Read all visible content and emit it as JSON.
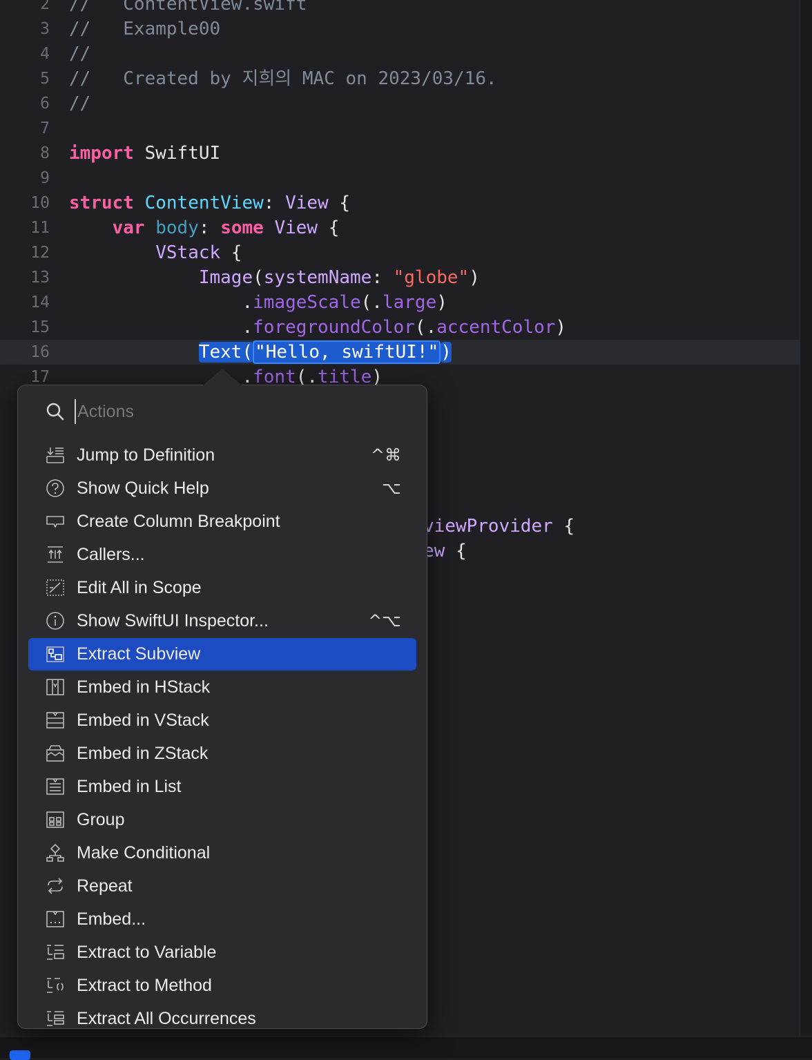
{
  "code_lines": [
    {
      "num": "2",
      "tokens": [
        {
          "t": "//   ContentView.swift",
          "c": "cm"
        }
      ]
    },
    {
      "num": "3",
      "tokens": [
        {
          "t": "//   Example00",
          "c": "cm"
        }
      ]
    },
    {
      "num": "4",
      "tokens": [
        {
          "t": "//",
          "c": "cm"
        }
      ]
    },
    {
      "num": "5",
      "tokens": [
        {
          "t": "//   Created by 지희의 MAC on 2023/03/16.",
          "c": "cm"
        }
      ]
    },
    {
      "num": "6",
      "tokens": [
        {
          "t": "//",
          "c": "cm"
        }
      ]
    },
    {
      "num": "7",
      "tokens": []
    },
    {
      "num": "8",
      "tokens": [
        {
          "t": "import",
          "c": "kw"
        },
        {
          "t": " SwiftUI",
          "c": ""
        }
      ]
    },
    {
      "num": "9",
      "tokens": []
    },
    {
      "num": "10",
      "tokens": [
        {
          "t": "struct",
          "c": "kw"
        },
        {
          "t": " ",
          "c": ""
        },
        {
          "t": "ContentView",
          "c": "td"
        },
        {
          "t": ": ",
          "c": ""
        },
        {
          "t": "View",
          "c": "tp"
        },
        {
          "t": " {",
          "c": ""
        }
      ]
    },
    {
      "num": "11",
      "tokens": [
        {
          "t": "    ",
          "c": ""
        },
        {
          "t": "var",
          "c": "kw"
        },
        {
          "t": " ",
          "c": ""
        },
        {
          "t": "body",
          "c": "pr"
        },
        {
          "t": ": ",
          "c": ""
        },
        {
          "t": "some",
          "c": "kw"
        },
        {
          "t": " ",
          "c": ""
        },
        {
          "t": "View",
          "c": "tp"
        },
        {
          "t": " {",
          "c": ""
        }
      ]
    },
    {
      "num": "12",
      "tokens": [
        {
          "t": "        ",
          "c": ""
        },
        {
          "t": "VStack",
          "c": "tp"
        },
        {
          "t": " {",
          "c": ""
        }
      ]
    },
    {
      "num": "13",
      "tokens": [
        {
          "t": "            ",
          "c": ""
        },
        {
          "t": "Image",
          "c": "tp"
        },
        {
          "t": "(",
          "c": ""
        },
        {
          "t": "systemName",
          "c": "tp"
        },
        {
          "t": ": ",
          "c": ""
        },
        {
          "t": "\"globe\"",
          "c": "st"
        },
        {
          "t": ")",
          "c": ""
        }
      ]
    },
    {
      "num": "14",
      "tokens": [
        {
          "t": "                .",
          "c": ""
        },
        {
          "t": "imageScale",
          "c": "mt"
        },
        {
          "t": "(.",
          "c": ""
        },
        {
          "t": "large",
          "c": "mt"
        },
        {
          "t": ")",
          "c": ""
        }
      ]
    },
    {
      "num": "15",
      "tokens": [
        {
          "t": "                .",
          "c": ""
        },
        {
          "t": "foregroundColor",
          "c": "mt"
        },
        {
          "t": "(.",
          "c": ""
        },
        {
          "t": "accentColor",
          "c": "mt"
        },
        {
          "t": ")",
          "c": ""
        }
      ]
    },
    {
      "num": "16",
      "current": true,
      "tokens": [
        {
          "t": "            ",
          "c": ""
        },
        {
          "t": "Text(",
          "c": "sel"
        },
        {
          "t": "\"Hello, swiftUI!\"",
          "c": "sel st selbox"
        },
        {
          "t": ")",
          "c": "sel"
        }
      ]
    },
    {
      "num": "17",
      "tokens": [
        {
          "t": "                .",
          "c": ""
        },
        {
          "t": "font",
          "c": "mt"
        },
        {
          "t": "(.",
          "c": ""
        },
        {
          "t": "title",
          "c": "mt"
        },
        {
          "t": ")",
          "c": ""
        }
      ]
    }
  ],
  "background_code": {
    "line_a": [
      {
        "t": "viewProvider",
        "c": "tp"
      },
      {
        "t": " {",
        "c": ""
      }
    ],
    "line_b": [
      {
        "t": "ew",
        "c": "tp"
      },
      {
        "t": " {",
        "c": ""
      }
    ]
  },
  "popup": {
    "search_placeholder": "Actions",
    "items": [
      {
        "label": "Jump to Definition",
        "shortcut": "^⌘",
        "icon": "jump-to-definition-icon"
      },
      {
        "label": "Show Quick Help",
        "shortcut": "⌥",
        "icon": "question-circle-icon"
      },
      {
        "label": "Create Column Breakpoint",
        "shortcut": "",
        "icon": "breakpoint-icon"
      },
      {
        "label": "Callers...",
        "shortcut": "",
        "icon": "callers-icon"
      },
      {
        "label": "Edit All in Scope",
        "shortcut": "",
        "icon": "edit-scope-icon"
      },
      {
        "label": "Show SwiftUI Inspector...",
        "shortcut": "^⌥",
        "icon": "info-circle-icon"
      },
      {
        "label": "Extract Subview",
        "shortcut": "",
        "icon": "extract-subview-icon",
        "active": true
      },
      {
        "label": "Embed in HStack",
        "shortcut": "",
        "icon": "hstack-icon"
      },
      {
        "label": "Embed in VStack",
        "shortcut": "",
        "icon": "vstack-icon"
      },
      {
        "label": "Embed in ZStack",
        "shortcut": "",
        "icon": "zstack-icon"
      },
      {
        "label": "Embed in List",
        "shortcut": "",
        "icon": "list-icon"
      },
      {
        "label": "Group",
        "shortcut": "",
        "icon": "group-icon"
      },
      {
        "label": "Make Conditional",
        "shortcut": "",
        "icon": "conditional-icon"
      },
      {
        "label": "Repeat",
        "shortcut": "",
        "icon": "repeat-icon"
      },
      {
        "label": "Embed...",
        "shortcut": "",
        "icon": "embed-icon"
      },
      {
        "label": "Extract to Variable",
        "shortcut": "",
        "icon": "extract-variable-icon"
      },
      {
        "label": "Extract to Method",
        "shortcut": "",
        "icon": "extract-method-icon"
      },
      {
        "label": "Extract All Occurrences",
        "shortcut": "",
        "icon": "extract-all-icon"
      }
    ]
  },
  "colors": {
    "editor_bg": "#1f1f24",
    "keyword": "#fc5fa3",
    "type": "#d0a8ff",
    "string": "#fc6a5d",
    "comment": "#7f8c98",
    "selection": "#1c5ccf",
    "menu_active": "#1d4cc2"
  }
}
